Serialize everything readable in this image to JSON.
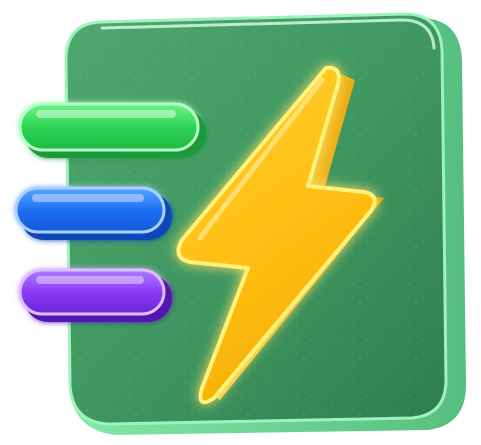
{
  "icon": {
    "name": "speed-lightning-app-icon",
    "colors": {
      "tile_fill": "#3f9a63",
      "tile_edge": "#7de8a5",
      "bolt_fill": "#ffc21a",
      "bolt_glow": "#ffe45a",
      "bar_top": "#38e05e",
      "bar_middle": "#1f78ff",
      "bar_bottom": "#8d3dff"
    }
  }
}
